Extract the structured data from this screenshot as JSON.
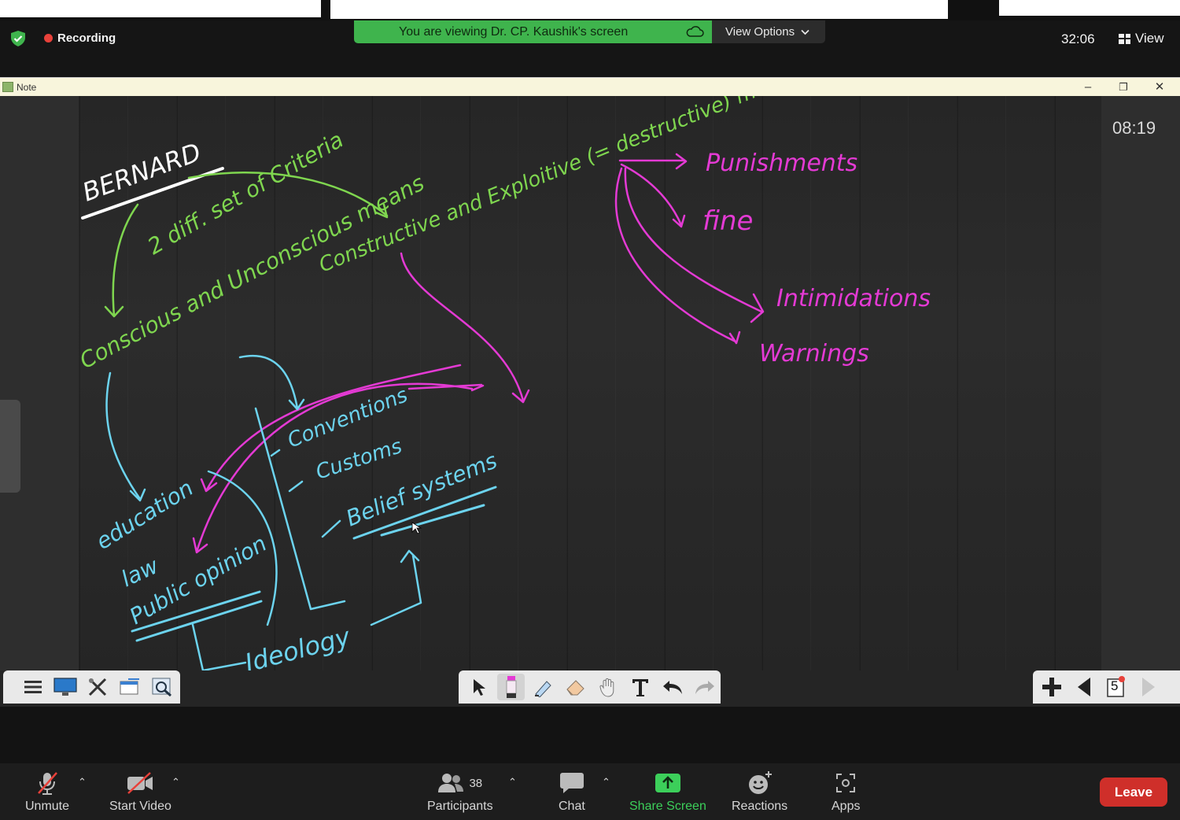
{
  "zoom_top": {
    "recording_label": "Recording",
    "viewing_banner": "You are viewing Dr. CP. Kaushik's screen",
    "view_options_label": "View Options",
    "meeting_timer": "32:06",
    "view_label": "View"
  },
  "note_window": {
    "title": "Note",
    "controls": {
      "minimize": "–",
      "restore": "❐",
      "close": "✕"
    },
    "board_timer": "08:19"
  },
  "whiteboard": {
    "heading": "BERNARD",
    "notes": [
      "2 diff. set of Criteria",
      "Conscious and Unconscious means",
      "Constructive and Exploitive (= destructive) means",
      "Punishments",
      "fine",
      "Intimidations",
      "Warnings",
      "Conventions",
      "Customs",
      "Belief systems",
      "education",
      "law",
      "Public opinion",
      "Ideology"
    ],
    "ink_colors": {
      "green": "#7fd64f",
      "magenta": "#e43ad4",
      "cyan": "#6cd3ee",
      "white": "#ffffff"
    }
  },
  "note_toolbar": {
    "left_tools": [
      "menu-icon",
      "display-icon",
      "tools-icon",
      "edit-page-icon",
      "image-search-icon"
    ],
    "middle_tools": [
      "select-icon",
      "pen-icon",
      "highlighter-icon",
      "eraser-icon",
      "hand-icon",
      "text-icon",
      "undo-icon",
      "redo-icon"
    ],
    "page_number": "5"
  },
  "zoom_bottom": {
    "unmute_label": "Unmute",
    "start_video_label": "Start Video",
    "participants_count": "38",
    "participants_label": "Participants",
    "chat_label": "Chat",
    "share_screen_label": "Share Screen",
    "reactions_label": "Reactions",
    "apps_label": "Apps",
    "leave_label": "Leave",
    "share_color": "#3ccf5a",
    "leave_color": "#cf2f2a"
  }
}
